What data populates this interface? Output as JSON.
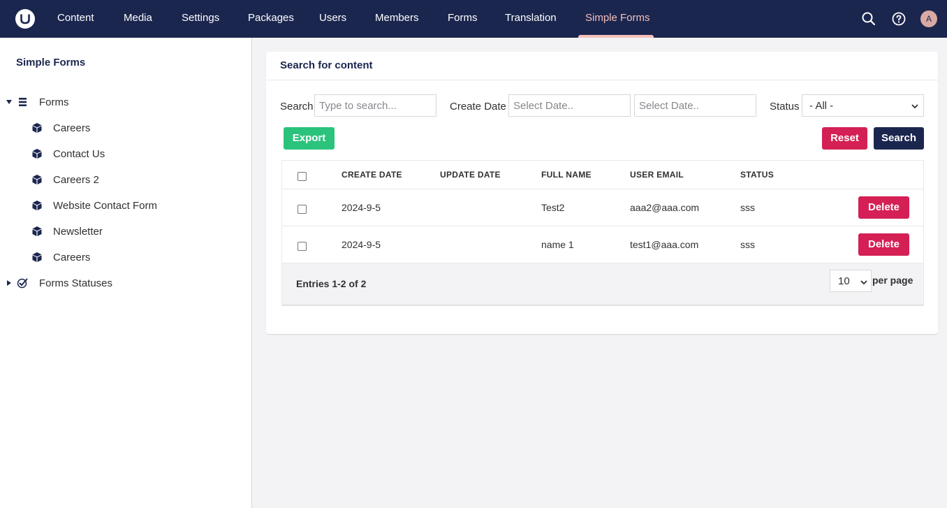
{
  "nav": {
    "items": [
      "Content",
      "Media",
      "Settings",
      "Packages",
      "Users",
      "Members",
      "Forms",
      "Translation",
      "Simple Forms"
    ],
    "active": "Simple Forms",
    "avatar_initial": "A"
  },
  "sidebar": {
    "title": "Simple Forms",
    "tree": {
      "forms_label": "Forms",
      "children": [
        "Careers",
        "Contact Us",
        "Careers 2",
        "Website Contact Form",
        "Newsletter",
        "Careers"
      ],
      "statuses_label": "Forms Statuses"
    }
  },
  "main": {
    "card_title": "Search for content",
    "filters": {
      "search_label": "Search",
      "search_placeholder": "Type to search...",
      "create_date_label": "Create Date",
      "date_from_placeholder": "Select Date..",
      "date_to_placeholder": "Select Date..",
      "status_label": "Status",
      "status_value": "- All -"
    },
    "buttons": {
      "export": "Export",
      "reset": "Reset",
      "search": "Search"
    },
    "table": {
      "columns": [
        "CREATE DATE",
        "UPDATE DATE",
        "FULL NAME",
        "USER EMAIL",
        "STATUS"
      ],
      "rows": [
        {
          "create_date": "2024-9-5",
          "update_date": "",
          "full_name": "Test2",
          "email": "aaa2@aaa.com",
          "status": "sss",
          "action": "Delete"
        },
        {
          "create_date": "2024-9-5",
          "update_date": "",
          "full_name": "name 1",
          "email": "test1@aaa.com",
          "status": "sss",
          "action": "Delete"
        }
      ],
      "entries_text": "Entries 1-2 of 2",
      "per_page_value": "10",
      "per_page_label": "per page"
    }
  },
  "colors": {
    "nav_bg": "#1b264f",
    "nav_active": "#f5c1bc",
    "export_green": "#2bc37c",
    "danger_red": "#d42054",
    "primary_navy": "#1b264f"
  }
}
